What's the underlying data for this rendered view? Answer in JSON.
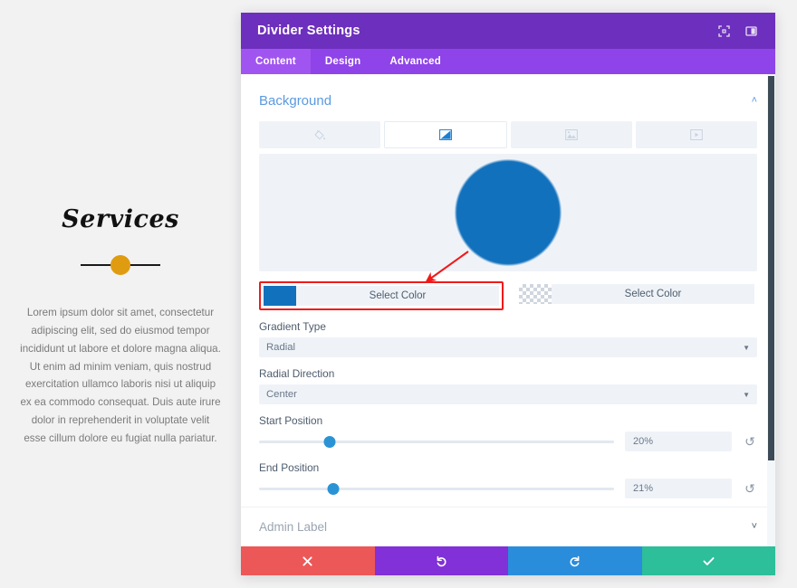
{
  "preview": {
    "title": "Services",
    "body": "Lorem ipsum dolor sit amet, consectetur adipiscing elit, sed do eiusmod tempor incididunt ut labore et dolore magna aliqua. Ut enim ad minim veniam, quis nostrud exercitation ullamco laboris nisi ut aliquip ex ea commodo consequat. Duis aute irure dolor in reprehenderit in voluptate velit esse cillum dolore eu fugiat nulla pariatur.",
    "divider_dot_color": "#e09c10",
    "divider_line_color": "#1a1a1a"
  },
  "modal": {
    "title": "Divider Settings",
    "header_color": "#6d2fbd",
    "tabbar_color": "#8e44e8",
    "header_icons": [
      {
        "name": "expand-icon",
        "label": "Expand"
      },
      {
        "name": "layout-panel-icon",
        "label": "Layout"
      }
    ],
    "tabs": [
      {
        "label": "Content",
        "active": true
      },
      {
        "label": "Design",
        "active": false
      },
      {
        "label": "Advanced",
        "active": false
      }
    ],
    "section": {
      "title": "Background",
      "collapsed": false,
      "chevron": "˄"
    },
    "bg_tabs": [
      {
        "name": "paint-bucket-icon",
        "label": "Background Color",
        "active": false
      },
      {
        "name": "gradient-icon",
        "label": "Background Gradient",
        "active": true
      },
      {
        "name": "image-icon",
        "label": "Background Image",
        "active": false
      },
      {
        "name": "video-icon",
        "label": "Background Video",
        "active": false
      }
    ],
    "gradient_preview": {
      "start_color": "#1271bd",
      "end_color": "#eff3f8",
      "shape": "radial",
      "stop_percent": 20
    },
    "color_buttons": [
      {
        "label": "Select Color",
        "swatch": "#1271bd",
        "type": "solid",
        "highlighted": true
      },
      {
        "label": "Select Color",
        "swatch": "transparent",
        "type": "transparent",
        "highlighted": false
      }
    ],
    "fields": [
      {
        "label": "Gradient Type",
        "value": "Radial"
      },
      {
        "label": "Radial Direction",
        "value": "Center"
      }
    ],
    "sliders": [
      {
        "label": "Start Position",
        "value": "20%",
        "percent": 20,
        "reset": "↺"
      },
      {
        "label": "End Position",
        "value": "21%",
        "percent": 21,
        "reset": "↺"
      }
    ],
    "admin_label": {
      "title": "Admin Label",
      "chevron": "˅"
    },
    "footer_buttons": [
      {
        "name": "cancel-button",
        "icon": "close-icon",
        "color": "#ec5858"
      },
      {
        "name": "undo-button",
        "icon": "undo-icon",
        "color": "#8230d8"
      },
      {
        "name": "redo-button",
        "icon": "redo-icon",
        "color": "#2a8ddb"
      },
      {
        "name": "save-button",
        "icon": "check-icon",
        "color": "#2dbe9a"
      }
    ]
  },
  "annotation": {
    "arrow_color": "#f01a1a",
    "highlight_color": "#f01a1a"
  }
}
